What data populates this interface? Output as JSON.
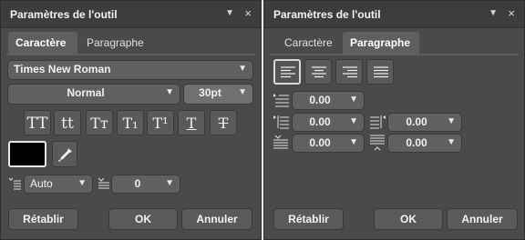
{
  "left_panel": {
    "title": "Paramètres de l'outil",
    "tabs": [
      {
        "label": "Caractère",
        "active": true
      },
      {
        "label": "Paragraphe",
        "active": false
      }
    ],
    "font_family": "Times New Roman",
    "font_style": "Normal",
    "font_size": "30pt",
    "format_buttons": [
      "TT",
      "tt",
      "Tᴛ",
      "T₁",
      "T¹",
      "T",
      "T"
    ],
    "color_swatch": "#000000",
    "leading_value": "Auto",
    "tracking_value": "0",
    "buttons": {
      "reset": "Rétablir",
      "ok": "OK",
      "cancel": "Annuler"
    }
  },
  "right_panel": {
    "title": "Paramètres de l'outil",
    "tabs": [
      {
        "label": "Caractère",
        "active": false
      },
      {
        "label": "Paragraphe",
        "active": true
      }
    ],
    "first_line_indent": "0.00",
    "left_indent": "0.00",
    "right_indent": "0.00",
    "space_before": "0.00",
    "space_after": "0.00",
    "buttons": {
      "reset": "Rétablir",
      "ok": "OK",
      "cancel": "Annuler"
    }
  },
  "icons": {
    "collapse": "▼",
    "close": "×",
    "eyedropper": "eyedropper-icon"
  }
}
